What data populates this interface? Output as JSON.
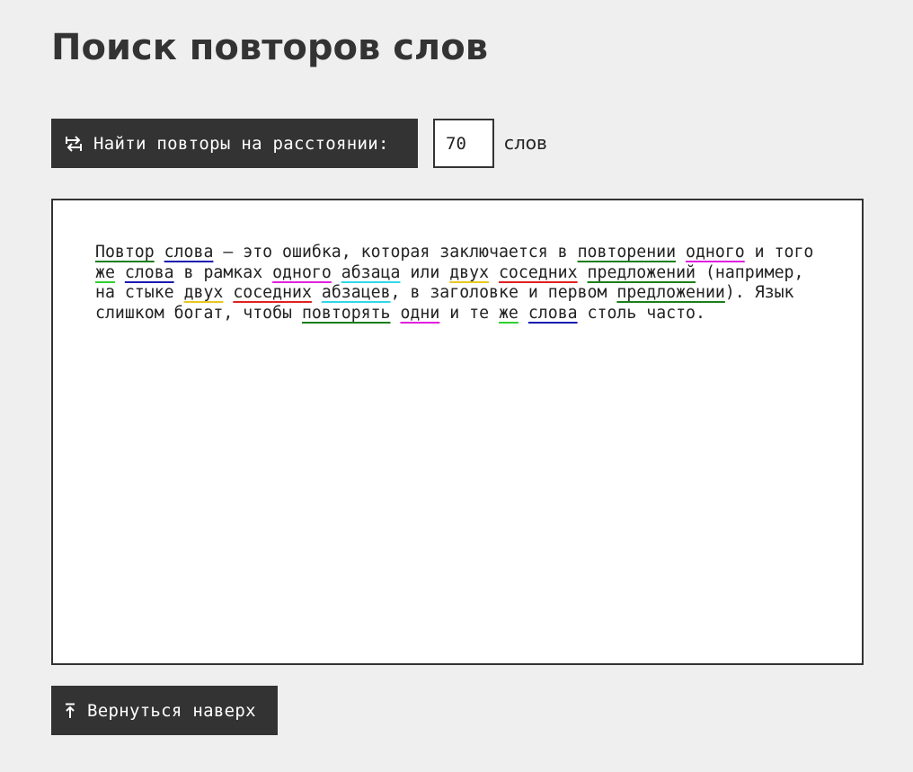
{
  "page": {
    "title": "Поиск повторов слов"
  },
  "controls": {
    "find_button_label": "Найти повторы на расстоянии:",
    "find_button_icon": "swap-arrows-icon",
    "distance_value": "70",
    "distance_unit": "слов"
  },
  "colors": {
    "dark": "#333333",
    "background": "#efefef",
    "editor_bg": "#ffffff"
  },
  "editor": {
    "segments": [
      {
        "t": "Повтор",
        "c": "#1a7f1a"
      },
      {
        "t": " "
      },
      {
        "t": "слова",
        "c": "#1a1ab0"
      },
      {
        "t": " — это ошибка, которая заключается в "
      },
      {
        "t": "повторении",
        "c": "#1a7f1a"
      },
      {
        "t": " "
      },
      {
        "t": "одного",
        "c": "#e020e0"
      },
      {
        "t": " и того "
      },
      {
        "t": "же",
        "c": "#30d030"
      },
      {
        "t": " "
      },
      {
        "t": "слова",
        "c": "#1a1ab0"
      },
      {
        "t": " в рамках "
      },
      {
        "t": "одного",
        "c": "#e020e0"
      },
      {
        "t": " "
      },
      {
        "t": "абзаца",
        "c": "#30d8e8"
      },
      {
        "t": " или "
      },
      {
        "t": "двух",
        "c": "#e8c820"
      },
      {
        "t": " "
      },
      {
        "t": "соседних",
        "c": "#e02020"
      },
      {
        "t": " "
      },
      {
        "t": "предложений",
        "c": "#1a7f1a"
      },
      {
        "t": " (например, на стыке "
      },
      {
        "t": "двух",
        "c": "#e8c820"
      },
      {
        "t": " "
      },
      {
        "t": "соседних",
        "c": "#e02020"
      },
      {
        "t": " "
      },
      {
        "t": "абзацев",
        "c": "#30d8e8"
      },
      {
        "t": ", в заголовке и первом "
      },
      {
        "t": "предложении",
        "c": "#1a7f1a"
      },
      {
        "t": "). Язык слишком богат, чтобы "
      },
      {
        "t": "повторять",
        "c": "#1a7f1a"
      },
      {
        "t": " "
      },
      {
        "t": "одни",
        "c": "#e020e0"
      },
      {
        "t": " и те "
      },
      {
        "t": "же",
        "c": "#30d030"
      },
      {
        "t": " "
      },
      {
        "t": "слова",
        "c": "#1a1ab0"
      },
      {
        "t": " столь часто."
      }
    ]
  },
  "footer": {
    "back_to_top_label": "Вернуться наверх",
    "back_to_top_icon": "arrow-up-to-line-icon"
  }
}
